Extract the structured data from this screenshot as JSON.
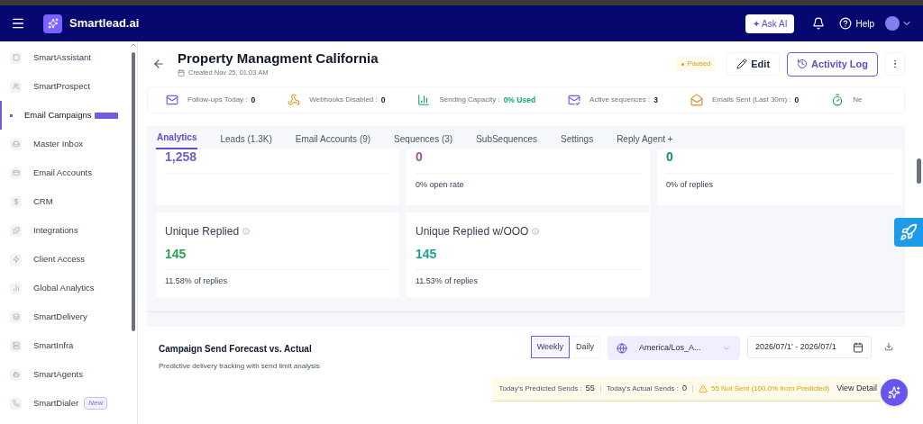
{
  "navbar": {
    "brand": "Smartlead.ai",
    "ask_ai": "✦ Ask AI",
    "help": "Help"
  },
  "sidebar": {
    "items": [
      {
        "label": "SmartAssistant",
        "selected": false
      },
      {
        "label": "SmartProspect",
        "selected": false
      },
      {
        "label": "Email Campaigns",
        "selected": true,
        "tag": true
      },
      {
        "label": "Master Inbox",
        "selected": false
      },
      {
        "label": "Email Accounts",
        "selected": false
      },
      {
        "label": "CRM",
        "selected": false
      },
      {
        "label": "Integrations",
        "selected": false
      },
      {
        "label": "Client Access",
        "selected": false
      },
      {
        "label": "Global Analytics",
        "selected": false
      },
      {
        "label": "SmartDelivery",
        "selected": false
      },
      {
        "label": "SmartInfra",
        "selected": false
      },
      {
        "label": "SmartAgents",
        "selected": false
      },
      {
        "label": "SmartDialer",
        "selected": false,
        "badge": "New"
      }
    ]
  },
  "campaign": {
    "title": "Property Managment California",
    "created": "Created Nov 25, 01:03 AM",
    "status": "Paused",
    "edit": "Edit",
    "activity_log": "Activity Log"
  },
  "stats": [
    {
      "label": "Follow-ups Today :",
      "value": "0",
      "kind": "plain"
    },
    {
      "label": "Webhooks Disabled :",
      "value": "0",
      "kind": "plain"
    },
    {
      "label": "Sending Capacity :",
      "value": "0% Used",
      "kind": "good"
    },
    {
      "label": "Active sequences :",
      "value": "3",
      "kind": "plain"
    },
    {
      "label": "Emails Sent (Last 30m) :",
      "value": "0",
      "kind": "plain"
    },
    {
      "label": "Ne"
    }
  ],
  "tabs": [
    {
      "label": "Analytics",
      "selected": true
    },
    {
      "label": "Leads (1.3K)",
      "selected": false
    },
    {
      "label": "Email Accounts (9)",
      "selected": false
    },
    {
      "label": "Sequences (3)",
      "selected": false
    },
    {
      "label": "SubSequences",
      "selected": false
    },
    {
      "label": "Settings",
      "selected": false
    },
    {
      "label": "Reply Agent +",
      "selected": false
    }
  ],
  "cards_top": [
    {
      "value": "1,258",
      "color": "#6b5fc9"
    },
    {
      "value": "0",
      "color": "#a0509a",
      "note": "0% open rate"
    },
    {
      "value": "0",
      "color": "#138a80",
      "note": "0% of replies"
    }
  ],
  "cards": [
    {
      "title": "Unique Replied",
      "value": "145",
      "color": "#2aa15a",
      "note": "11.58% of replies"
    },
    {
      "title": "Unique Replied w/OOO",
      "value": "145",
      "color": "#1f9f94",
      "note": "11.53% of replies"
    }
  ],
  "forecast": {
    "title": "Campaign Send Forecast vs. Actual",
    "subtitle": "Predictive delivery tracking with send limit analysis",
    "periods": [
      {
        "label": "Weekly",
        "selected": true
      },
      {
        "label": "Daily",
        "selected": false
      }
    ],
    "timezone": "America/Los_A...",
    "date_range": "2026/07/1' - 2026/07/1",
    "predicted": "Today's Predicted Sends :",
    "predicted_value": "55",
    "actual": "Today's Actual Sends :",
    "actual_value": "0",
    "warning": "55 Not Sent (100.0% from Predicted)",
    "details": "View Detail"
  }
}
